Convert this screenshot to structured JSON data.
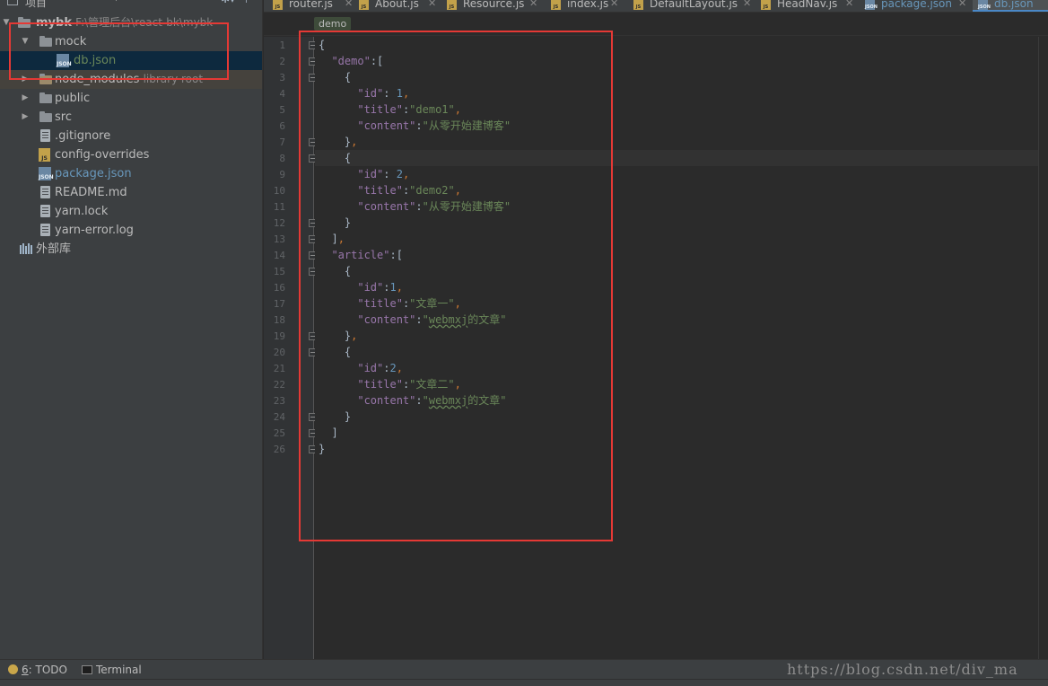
{
  "panel": {
    "title": "项目",
    "tree": [
      {
        "label": "mybk",
        "suffix": "F:\\管理后台\\react-bk\\mybk"
      },
      {
        "label": "mock"
      },
      {
        "label": "db.json"
      },
      {
        "label": "node_modules",
        "suffix": "library root"
      },
      {
        "label": "public"
      },
      {
        "label": "src"
      },
      {
        "label": ".gitignore"
      },
      {
        "label": "config-overrides"
      },
      {
        "label": "package.json"
      },
      {
        "label": "README.md"
      },
      {
        "label": "yarn.lock"
      },
      {
        "label": "yarn-error.log"
      },
      {
        "label": "外部库"
      }
    ]
  },
  "tabs": [
    {
      "label": "router.js"
    },
    {
      "label": "About.js"
    },
    {
      "label": "Resource.js"
    },
    {
      "label": "index.js"
    },
    {
      "label": "DefaultLayout.js"
    },
    {
      "label": "HeadNav.js"
    },
    {
      "label": "package.json"
    },
    {
      "label": "db.json"
    }
  ],
  "breadcrumb": "demo",
  "code": {
    "lines": [
      "1",
      "2",
      "3",
      "4",
      "5",
      "6",
      "7",
      "8",
      "9",
      "10",
      "11",
      "12",
      "13",
      "14",
      "15",
      "16",
      "17",
      "18",
      "19",
      "20",
      "21",
      "22",
      "23",
      "24",
      "25",
      "26"
    ],
    "demo_key": "\"demo\"",
    "article_key": "\"article\"",
    "id_key": "\"id\"",
    "title_key": "\"title\"",
    "content_key": "\"content\"",
    "demo1_id": "1",
    "demo1_title": "\"demo1\"",
    "demo1_content": "\"从零开始建博客\"",
    "demo2_id": "2",
    "demo2_title": "\"demo2\"",
    "demo2_content": "\"从零开始建博客\"",
    "art1_id": "1",
    "art1_title": "\"文章一\"",
    "art1_content_word": "webmxj",
    "art1_content_rest": "的文章\"",
    "art2_id": "2",
    "art2_title": "\"文章二\"",
    "art2_content_word": "webmxj",
    "art2_content_rest": "的文章\""
  },
  "bottom": {
    "todo_mnemonic": "6",
    "todo_label": ": TODO",
    "terminal_label": "Terminal",
    "watermark": "https://blog.csdn.net/div_ma"
  },
  "colors": {
    "annotation": "#e53935",
    "key": "#9876aa",
    "string": "#6a8759",
    "number": "#6897bb",
    "punct": "#cc7832"
  }
}
